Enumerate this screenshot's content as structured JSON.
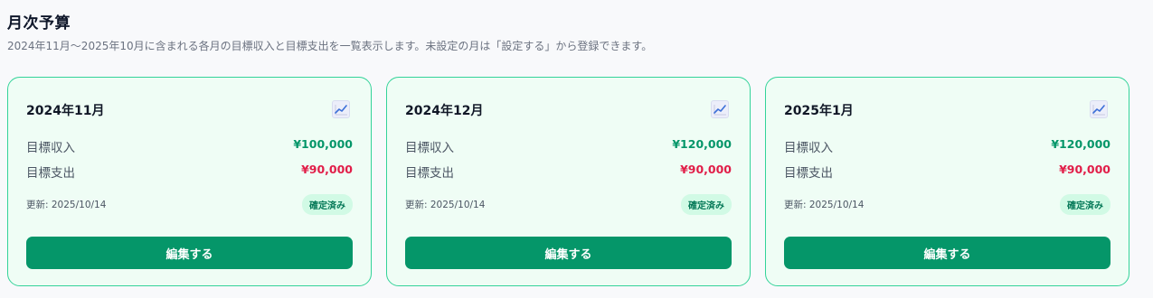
{
  "header": {
    "title": "月次予算",
    "description": "2024年11月〜2025年10月に含まれる各月の目標収入と目標支出を一覧表示します。未設定の月は「設定する」から登録できます。"
  },
  "colors": {
    "accent": "#059669",
    "income": "#059669",
    "expense": "#e11d48",
    "card_border": "#34d399",
    "card_bg": "#effdf5"
  },
  "cards": [
    {
      "month": "2024年11月",
      "icon": "chart-increasing-icon",
      "income_label": "目標収入",
      "income_value": "¥100,000",
      "expense_label": "目標支出",
      "expense_value": "¥90,000",
      "updated": "更新: 2025/10/14",
      "status": "確定済み",
      "button": "編集する"
    },
    {
      "month": "2024年12月",
      "icon": "chart-increasing-icon",
      "income_label": "目標収入",
      "income_value": "¥120,000",
      "expense_label": "目標支出",
      "expense_value": "¥90,000",
      "updated": "更新: 2025/10/14",
      "status": "確定済み",
      "button": "編集する"
    },
    {
      "month": "2025年1月",
      "icon": "chart-increasing-icon",
      "income_label": "目標収入",
      "income_value": "¥120,000",
      "expense_label": "目標支出",
      "expense_value": "¥90,000",
      "updated": "更新: 2025/10/14",
      "status": "確定済み",
      "button": "編集する"
    }
  ]
}
